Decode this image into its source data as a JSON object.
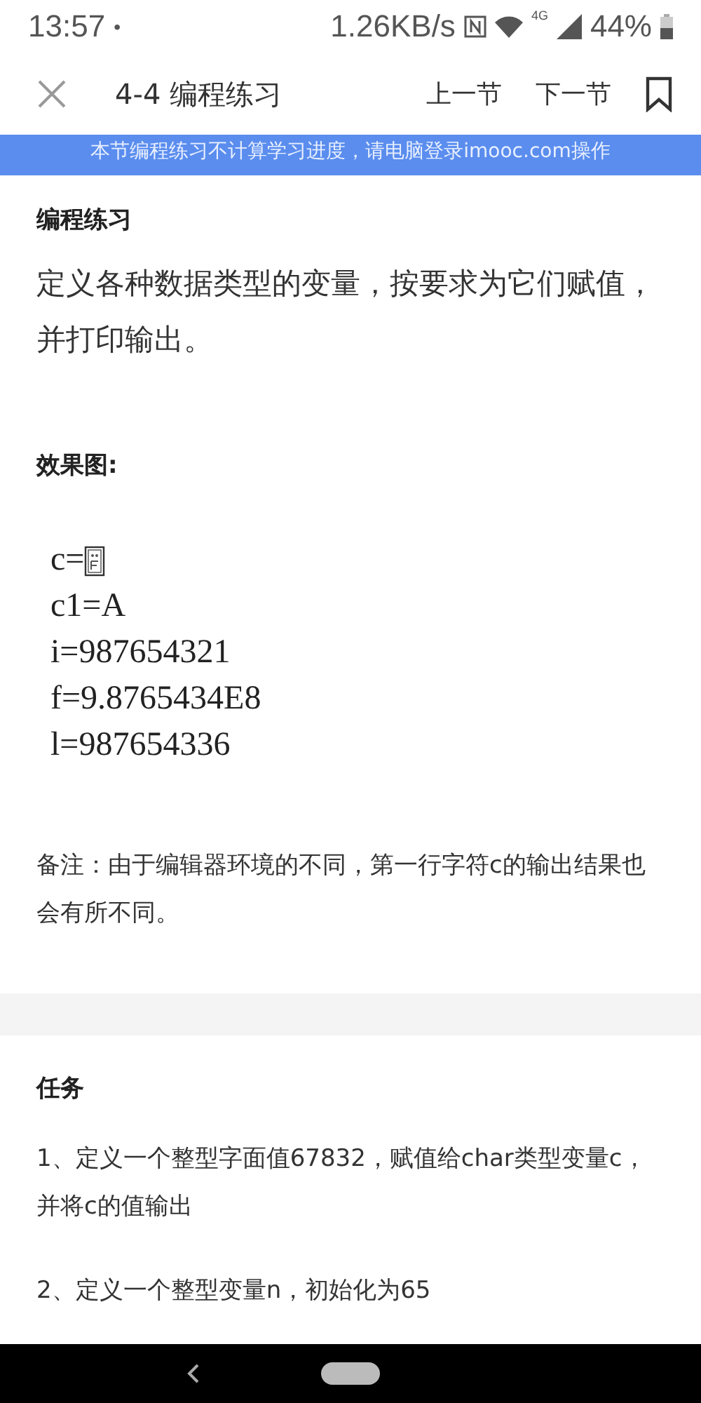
{
  "status_bar": {
    "time": "13:57",
    "dot": "•",
    "speed": "1.26KB/s",
    "network": "4G",
    "battery": "44%"
  },
  "header": {
    "title": "4-4 编程练习",
    "prev": "上一节",
    "next": "下一节"
  },
  "notice": "本节编程练习不计算学习进度，请电脑登录imooc.com操作",
  "exercise": {
    "heading": "编程练习",
    "description": "定义各种数据类型的变量，按要求为它们赋值，并打印输出。",
    "result_heading": "效果图:",
    "output_lines": [
      {
        "text": "c=",
        "missing_glyph": true
      },
      {
        "text": "c1=A",
        "missing_glyph": false
      },
      {
        "text": "i=987654321",
        "missing_glyph": false
      },
      {
        "text": "f=9.8765434E8",
        "missing_glyph": false
      },
      {
        "text": "l=987654336",
        "missing_glyph": false
      }
    ],
    "note": "备注：由于编辑器环境的不同，第一行字符c的输出结果也会有所不同。"
  },
  "task": {
    "heading": "任务",
    "items": [
      "1、定义一个整型字面值67832，赋值给char类型变量c，并将c的值输出",
      "2、定义一个整型变量n，初始化为65"
    ]
  }
}
